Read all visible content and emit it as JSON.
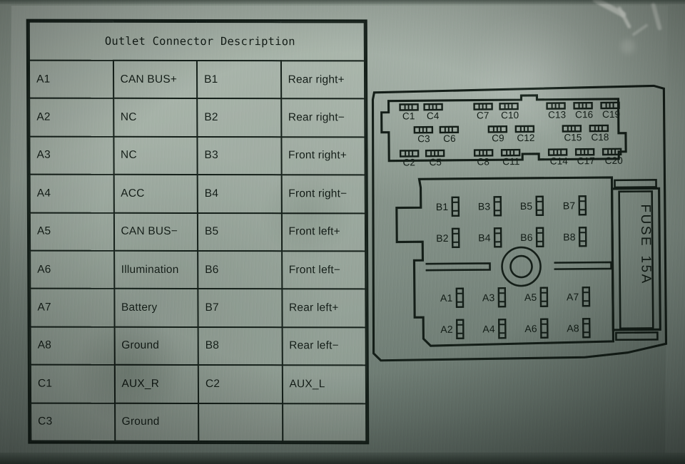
{
  "plate": {
    "title": "Outlet Connector Description"
  },
  "table": {
    "title": "Outlet Connector Description",
    "rows": [
      {
        "code_left": "A1",
        "desc_left": "CAN BUS+",
        "code_right": "B1",
        "desc_right": "Rear right+"
      },
      {
        "code_left": "A2",
        "desc_left": "NC",
        "code_right": "B2",
        "desc_right": "Rear right−"
      },
      {
        "code_left": "A3",
        "desc_left": "NC",
        "code_right": "B3",
        "desc_right": "Front right+"
      },
      {
        "code_left": "A4",
        "desc_left": "ACC",
        "code_right": "B4",
        "desc_right": "Front right−"
      },
      {
        "code_left": "A5",
        "desc_left": "CAN BUS−",
        "code_right": "B5",
        "desc_right": "Front left+"
      },
      {
        "code_left": "A6",
        "desc_left": "Illumination",
        "code_right": "B6",
        "desc_right": "Front left−"
      },
      {
        "code_left": "A7",
        "desc_left": "Battery",
        "code_right": "B7",
        "desc_right": "Rear left+"
      },
      {
        "code_left": "A8",
        "desc_left": "Ground",
        "code_right": "B8",
        "desc_right": "Rear left−"
      },
      {
        "code_left": "C1",
        "desc_left": "AUX_R",
        "code_right": "C2",
        "desc_right": "AUX_L"
      },
      {
        "code_left": "C3",
        "desc_left": "Ground",
        "code_right": "",
        "desc_right": ""
      }
    ]
  },
  "diagram": {
    "c_connector": {
      "row_top": [
        "C1",
        "C4",
        "C7",
        "C10",
        "C13",
        "C16",
        "C19"
      ],
      "row_middle": [
        "C3",
        "C6",
        "C9",
        "C12",
        "C15",
        "C18"
      ],
      "row_bottom": [
        "C2",
        "C5",
        "C8",
        "C11",
        "C14",
        "C17",
        "C20"
      ]
    },
    "b_connector": {
      "row_top": [
        "B1",
        "B3",
        "B5",
        "B7"
      ],
      "row_bottom": [
        "B2",
        "B4",
        "B6",
        "B8"
      ]
    },
    "a_connector": {
      "row_top": [
        "A1",
        "A3",
        "A5",
        "A7"
      ],
      "row_bottom": [
        "A2",
        "A4",
        "A6",
        "A8"
      ]
    },
    "fuse": {
      "label": "FUSE",
      "rating": "15A"
    }
  },
  "colors": {
    "plate_background": "#8d9a90",
    "ink": "#141e18",
    "label_face": "#b6c2b7"
  }
}
